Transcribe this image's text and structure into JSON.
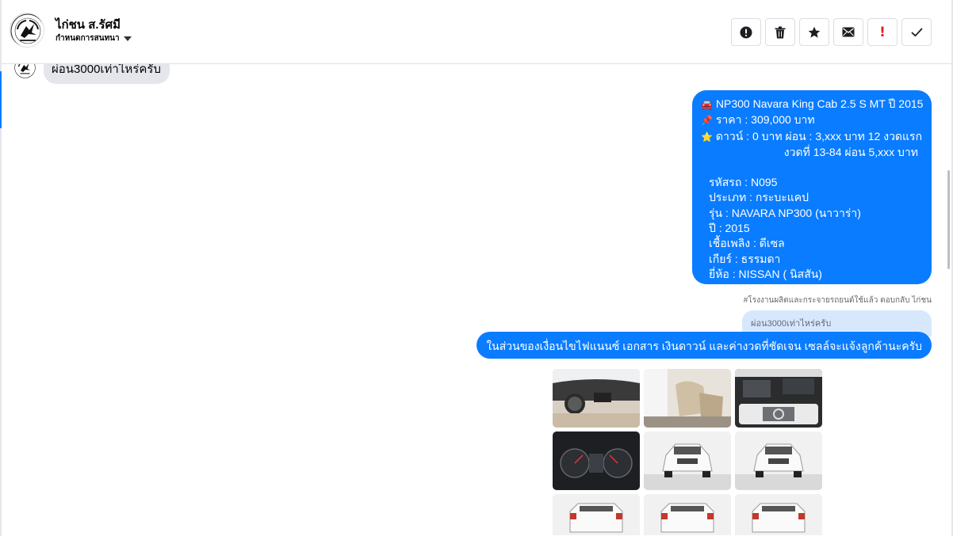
{
  "header": {
    "contact_name": "ไก่ชน ส.รัศมี",
    "subtitle": "กำหนดการสนทนา",
    "actions": [
      {
        "name": "info-button",
        "icon": "alert-circle-icon"
      },
      {
        "name": "delete-button",
        "icon": "trash-icon"
      },
      {
        "name": "star-button",
        "icon": "star-icon"
      },
      {
        "name": "mail-button",
        "icon": "envelope-icon"
      },
      {
        "name": "spam-button",
        "icon": "exclamation-icon",
        "label": "!"
      },
      {
        "name": "done-button",
        "icon": "check-icon"
      }
    ]
  },
  "messages": {
    "peek_incoming": "ผ่อน3000เท่าไหร่ครับ",
    "listing": {
      "title": "NP300 Navara King Cab 2.5 S MT ปี 2015",
      "price": "ราคา : 309,000 บาท",
      "down_payment": "ดาวน์ : 0 บาท ผ่อน : 3,xxx บาท 12 งวดแรก",
      "installments": "งวดที่ 13-84 ผ่อน 5,xxx บาท",
      "code": "รหัสรถ : N095",
      "type": "ประเภท : กระบะแคป",
      "model": "รุ่น : NAVARA NP300 (นาวาร่า)",
      "year": "ปี : 2015",
      "fuel": "เชื้อเพลิง : ดีเซล",
      "gear": "เกียร์ : ธรรมดา",
      "brand": "ยี่ห้อ : NISSAN ( นิสสัน)"
    },
    "reply_meta": "#โรงงานผลิตและกระจายรถยนต์ใช้แล้ว ตอบกลับ ไก่ชน",
    "quoted_text": "ผ่อน3000เท่าไหร่ครับ",
    "reply_text": "ในส่วนของเงื่อนไขไฟแนนซ์ เอกสาร เงินดาวน์ และค่างวดที่ชัดเจน เซลล์จะแจ้งลูกค้านะครับ",
    "gallery": [
      {
        "name": "photo-dashboard"
      },
      {
        "name": "photo-rear-seat"
      },
      {
        "name": "photo-engine-bay"
      },
      {
        "name": "photo-gauge-cluster"
      },
      {
        "name": "photo-front-view"
      },
      {
        "name": "photo-front-view-2"
      },
      {
        "name": "photo-rear-view"
      },
      {
        "name": "photo-rear-view-2"
      },
      {
        "name": "photo-rear-view-3"
      }
    ]
  },
  "colors": {
    "accent": "#0a7cff",
    "incoming_bubble": "#e4e6eb",
    "quoted_bubble": "#d8e8fc",
    "spam_red": "#e02424"
  }
}
